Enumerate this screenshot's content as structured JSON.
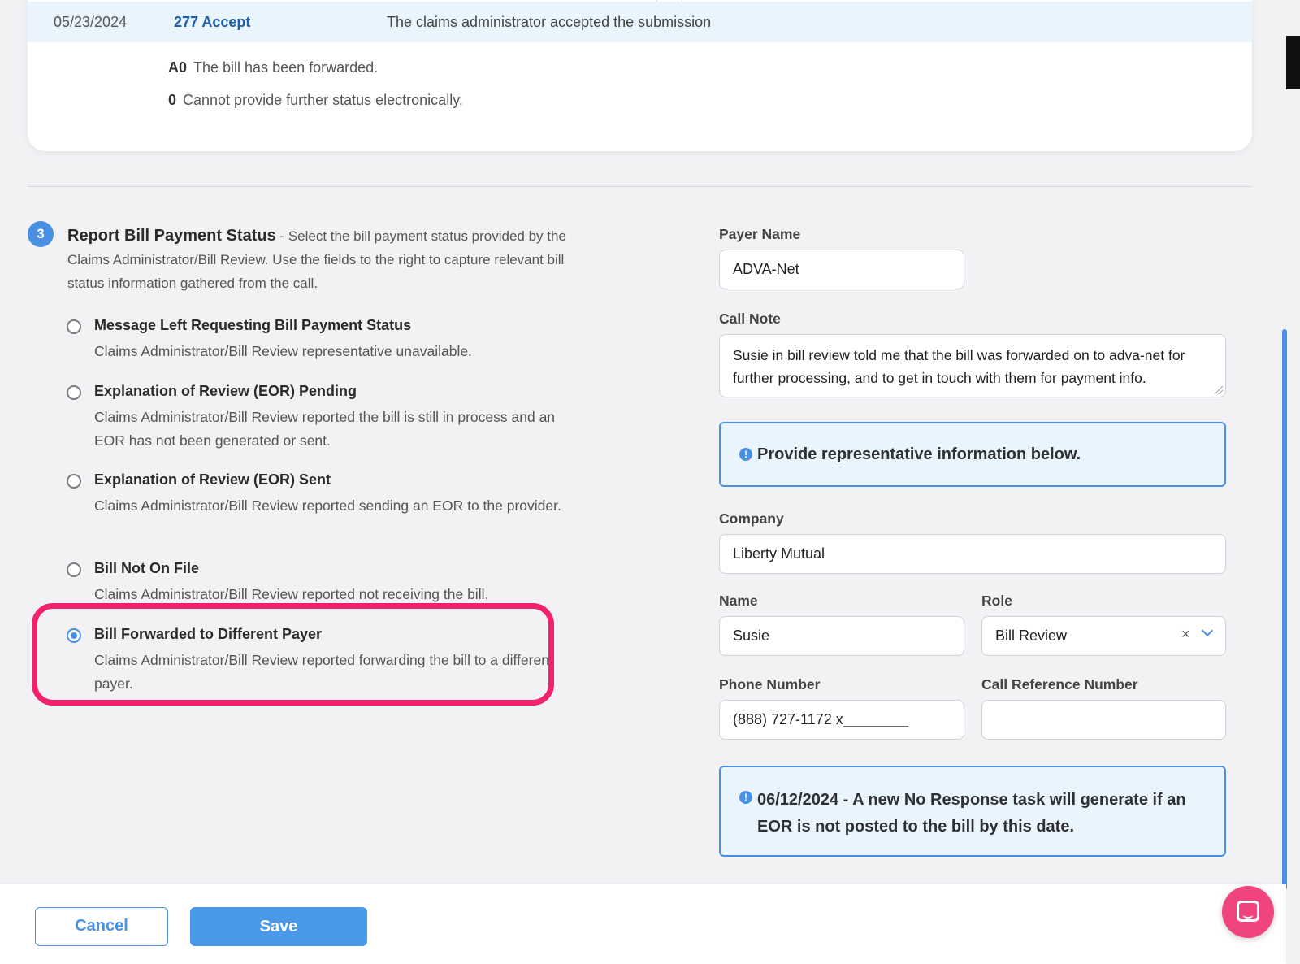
{
  "history": {
    "date": "05/23/2024",
    "code": "277 Accept",
    "description": "The claims administrator accepted the submission",
    "statuses": [
      {
        "code": "A0",
        "text": "The bill has been forwarded."
      },
      {
        "code": "0",
        "text": "Cannot provide further status electronically."
      }
    ]
  },
  "section": {
    "step": "3",
    "title": "Report Bill Payment Status",
    "description": " - Select the bill payment status provided by the Claims Administrator/Bill Review. Use the fields to the right to capture relevant bill status information gathered from the call.",
    "options": [
      {
        "title": "Message Left Requesting Bill Payment Status",
        "description": "Claims Administrator/Bill Review representative unavailable.",
        "selected": false
      },
      {
        "title": "Explanation of Review (EOR) Pending",
        "description": "Claims Administrator/Bill Review reported the bill is still in process and an EOR has not been generated or sent.",
        "selected": false
      },
      {
        "title": "Explanation of Review (EOR) Sent",
        "description": "Claims Administrator/Bill Review reported sending an EOR to the provider.",
        "selected": false
      },
      {
        "title": "Bill Not On File",
        "description": "Claims Administrator/Bill Review reported not receiving the bill.",
        "selected": false
      },
      {
        "title": "Bill Forwarded to Different Payer",
        "description": "Claims Administrator/Bill Review reported forwarding the bill to a different payer.",
        "selected": true
      }
    ]
  },
  "form": {
    "payer_name_label": "Payer Name",
    "payer_name_value": "ADVA-Net",
    "call_note_label": "Call Note",
    "call_note_value": "Susie in bill review told me that the bill was forwarded on to adva-net for further processing, and to get in touch with them for payment info.",
    "info_message": "Provide representative information below.",
    "company_label": "Company",
    "company_value": "Liberty Mutual",
    "name_label": "Name",
    "name_value": "Susie",
    "role_label": "Role",
    "role_value": "Bill Review",
    "role_clear": "×",
    "phone_label": "Phone Number",
    "phone_value": "(888) 727-1172 x________",
    "call_ref_label": "Call Reference Number",
    "call_ref_value": "",
    "deadline_message": "06/12/2024 - A new No Response task will generate if an EOR is not posted to the bill by this date."
  },
  "footer": {
    "cancel_label": "Cancel",
    "save_label": "Save"
  },
  "colors": {
    "accent": "#4a90e2",
    "highlight": "#f2216d",
    "chat": "#f0447f"
  }
}
